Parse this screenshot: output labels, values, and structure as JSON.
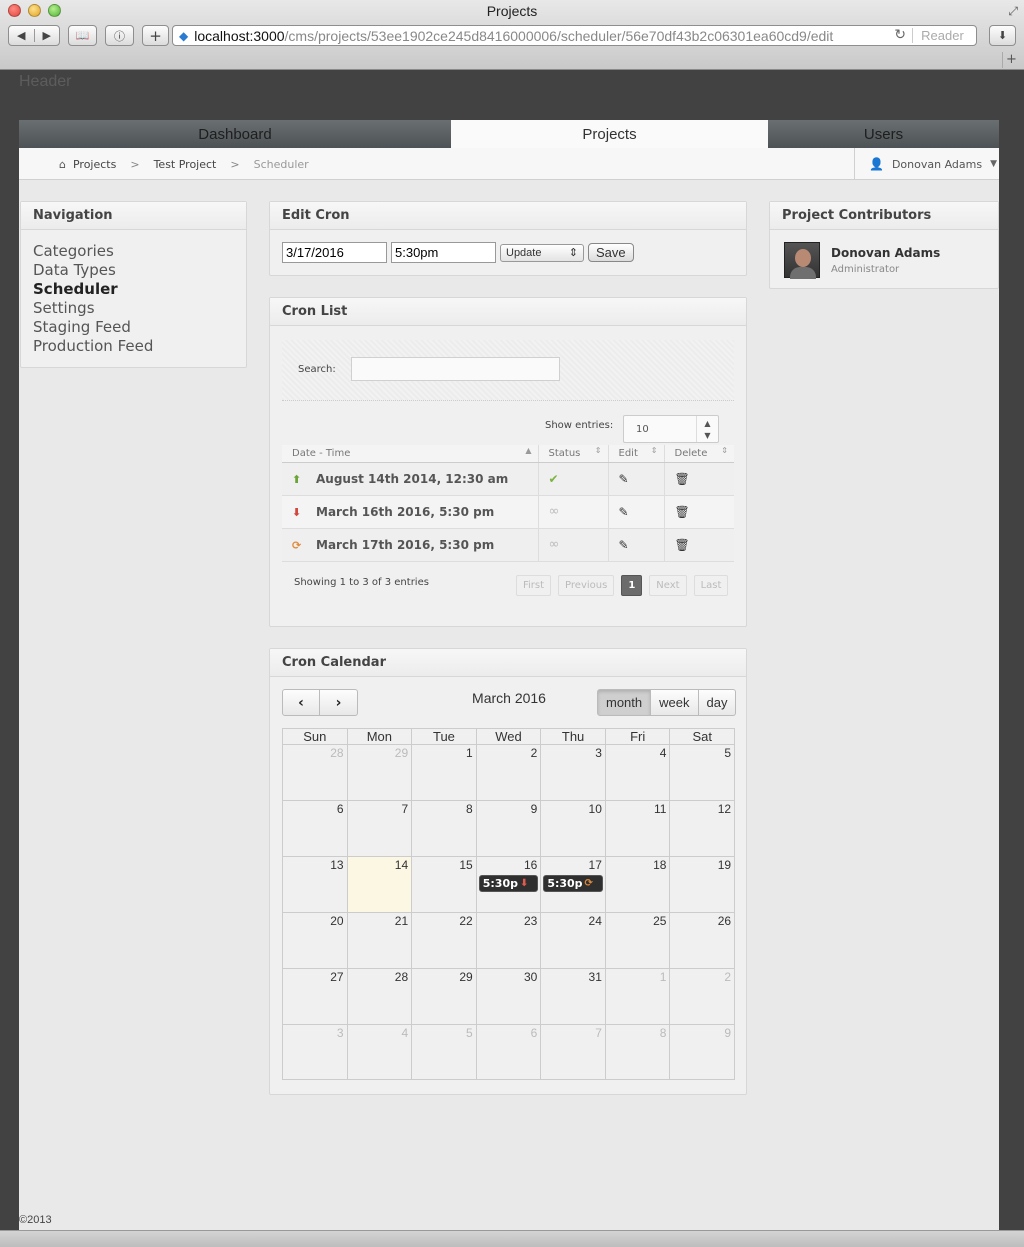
{
  "browser": {
    "window_title": "Projects",
    "url_host": "localhost:3000",
    "url_path": "/cms/projects/53ee1902ce245d8416000006/scheduler/56e70df43b2c06301ea60cd9/edit",
    "reader_label": "Reader"
  },
  "page": {
    "header_label": "Header",
    "copyright": "©2013"
  },
  "topnav": {
    "tabs": [
      {
        "label": "Dashboard"
      },
      {
        "label": "Projects"
      },
      {
        "label": "Users"
      }
    ]
  },
  "breadcrumb": {
    "items": [
      "Projects",
      "Test Project",
      "Scheduler"
    ]
  },
  "user": {
    "name": "Donovan Adams"
  },
  "navigation": {
    "title": "Navigation",
    "items": [
      "Categories",
      "Data Types",
      "Scheduler",
      "Settings",
      "Staging Feed",
      "Production Feed"
    ]
  },
  "edit_cron": {
    "title": "Edit Cron",
    "date": "3/17/2016",
    "time": "5:30pm",
    "action": "Update",
    "save_label": "Save"
  },
  "cron_list": {
    "title": "Cron List",
    "search_label": "Search:",
    "show_label": "Show entries:",
    "show_value": "10",
    "columns": [
      "Date - Time",
      "Status",
      "Edit",
      "Delete"
    ],
    "rows": [
      {
        "datetime": "August 14th 2014, 12:30 am"
      },
      {
        "datetime": "March 16th 2016, 5:30 pm"
      },
      {
        "datetime": "March 17th 2016, 5:30 pm"
      }
    ],
    "info": "Showing 1 to 3 of 3 entries",
    "pager": [
      "First",
      "Previous",
      "1",
      "Next",
      "Last"
    ]
  },
  "calendar": {
    "title": "Cron Calendar",
    "month_label": "March 2016",
    "views": [
      "month",
      "week",
      "day"
    ],
    "weekdays": [
      "Sun",
      "Mon",
      "Tue",
      "Wed",
      "Thu",
      "Fri",
      "Sat"
    ],
    "weeks": [
      [
        "28",
        "29",
        "1",
        "2",
        "3",
        "4",
        "5"
      ],
      [
        "6",
        "7",
        "8",
        "9",
        "10",
        "11",
        "12"
      ],
      [
        "13",
        "14",
        "15",
        "16",
        "17",
        "18",
        "19"
      ],
      [
        "20",
        "21",
        "22",
        "23",
        "24",
        "25",
        "26"
      ],
      [
        "27",
        "28",
        "29",
        "30",
        "31",
        "1",
        "2"
      ],
      [
        "3",
        "4",
        "5",
        "6",
        "7",
        "8",
        "9"
      ]
    ],
    "events": [
      {
        "label": "5:30p"
      },
      {
        "label": "5:30p"
      }
    ]
  },
  "contributors": {
    "title": "Project Contributors",
    "people": [
      {
        "name": "Donovan Adams",
        "role": "Administrator"
      }
    ]
  }
}
